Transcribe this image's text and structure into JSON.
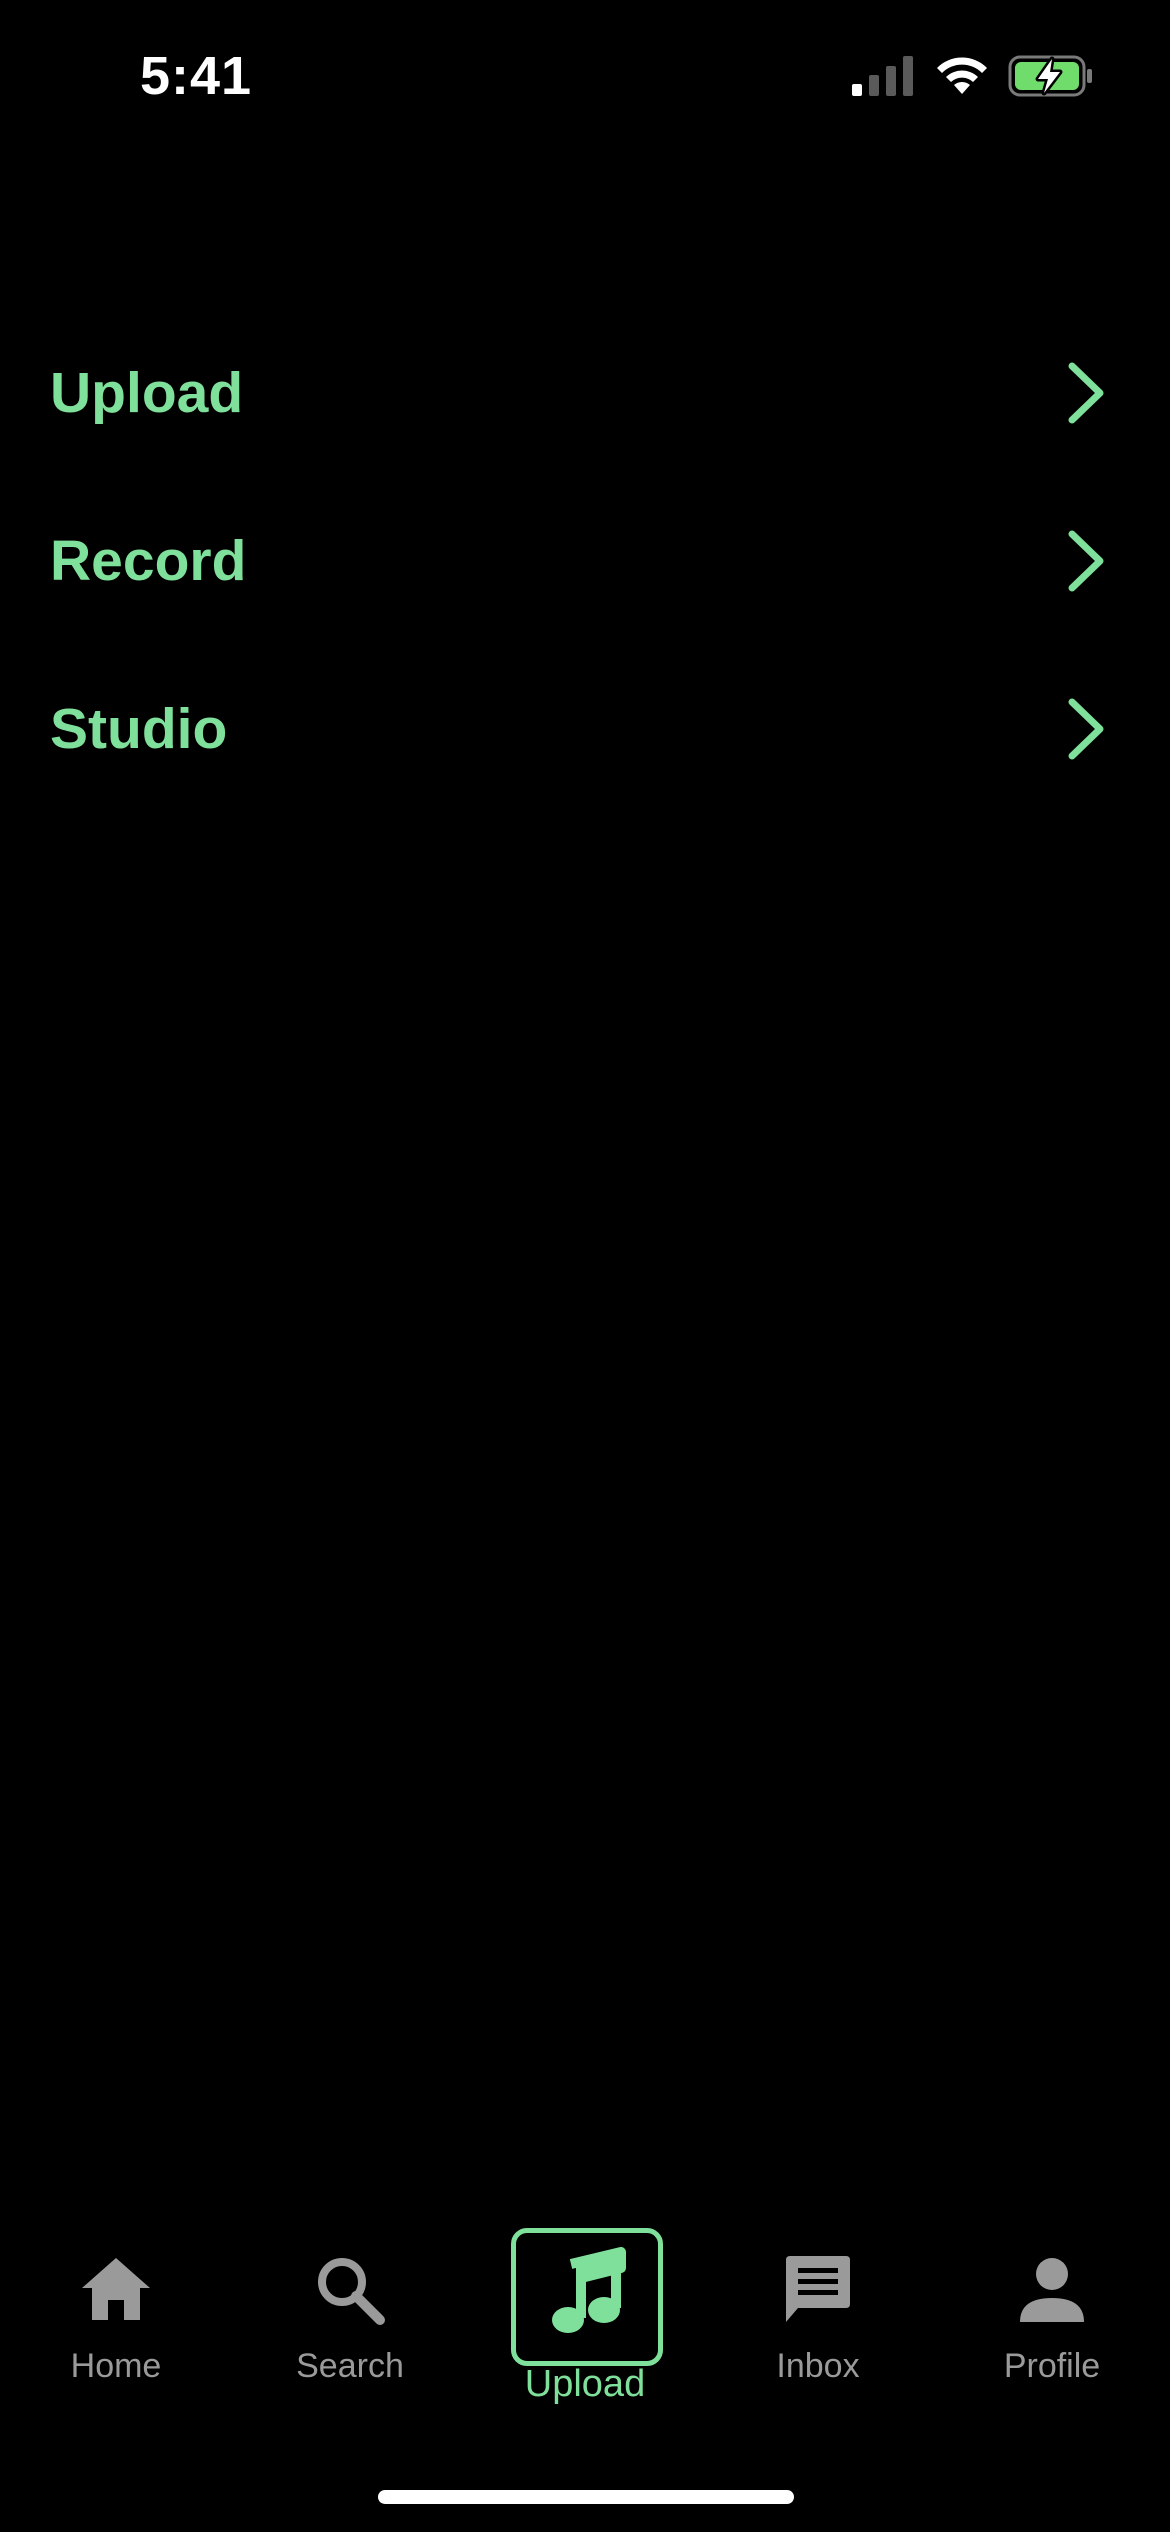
{
  "status_bar": {
    "time": "5:41"
  },
  "menu": {
    "items": [
      {
        "label": "Upload",
        "icon": "chevron-right-icon"
      },
      {
        "label": "Record",
        "icon": "chevron-right-icon"
      },
      {
        "label": "Studio",
        "icon": "chevron-right-icon"
      }
    ]
  },
  "tab_bar": {
    "tabs": [
      {
        "label": "Home",
        "icon": "home-icon",
        "selected": false
      },
      {
        "label": "Search",
        "icon": "search-icon",
        "selected": false
      },
      {
        "label": "Upload",
        "icon": "music-note-icon",
        "selected": true
      },
      {
        "label": "Inbox",
        "icon": "message-icon",
        "selected": false
      },
      {
        "label": "Profile",
        "icon": "person-icon",
        "selected": false
      }
    ]
  },
  "colors": {
    "background": "#000000",
    "accent": "#7ee09a",
    "inactive": "#9a9a9a",
    "status_text": "#ffffff"
  }
}
